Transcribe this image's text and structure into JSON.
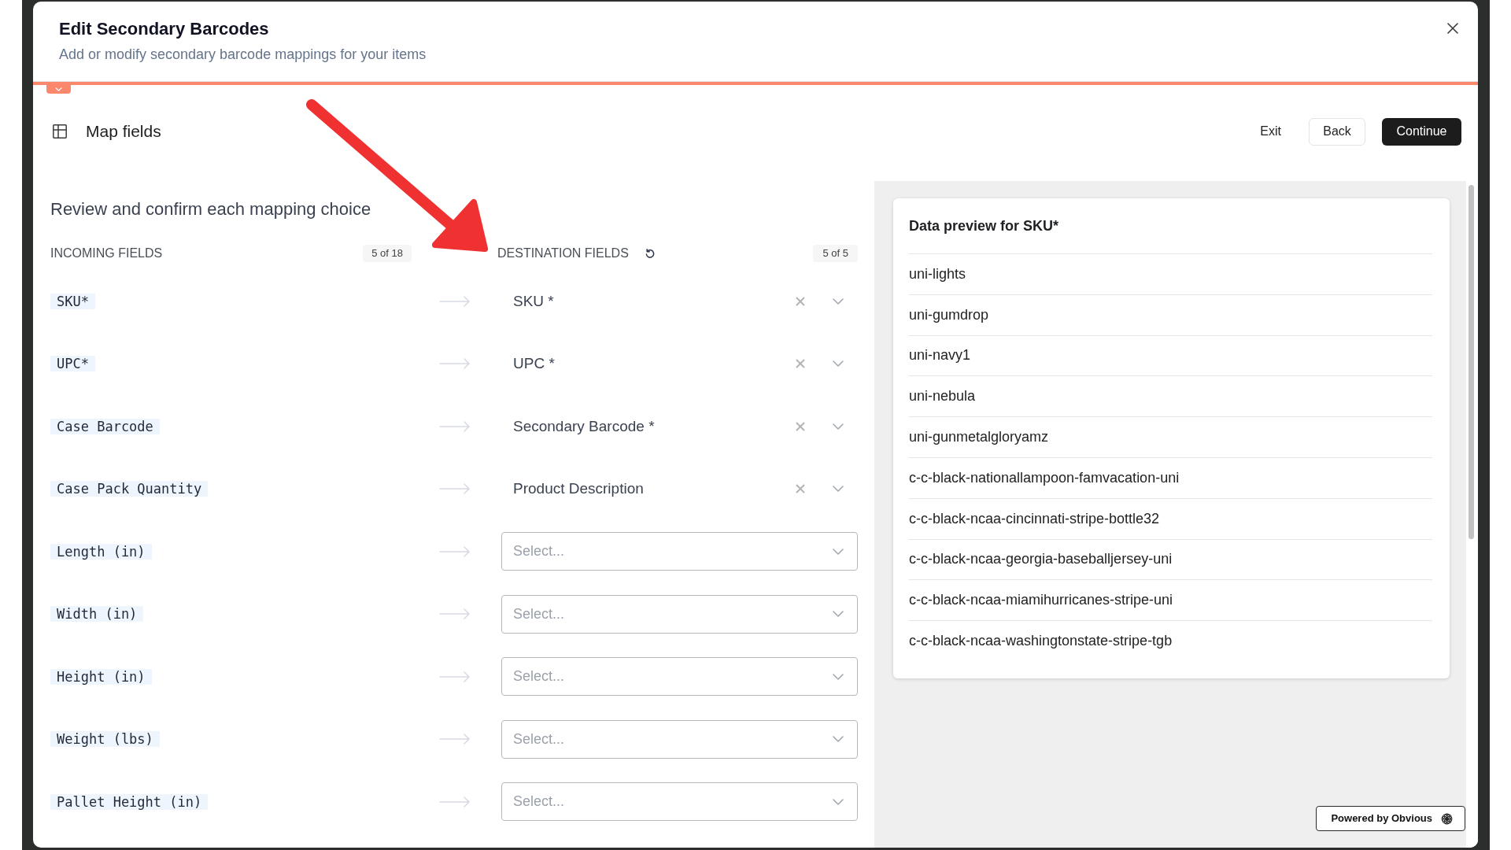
{
  "dialog": {
    "title": "Edit Secondary Barcodes",
    "subtitle": "Add or modify secondary barcode mappings for your items"
  },
  "header_toggle": {
    "expanded": true
  },
  "step": {
    "title": "Map fields",
    "actions": [
      {
        "label": "Exit",
        "kind": "text"
      },
      {
        "label": "Back",
        "kind": "outline"
      },
      {
        "label": "Continue",
        "kind": "primary"
      }
    ]
  },
  "mapping": {
    "heading": "Review and confirm each mapping choice",
    "incoming": {
      "label": "INCOMING FIELDS",
      "count": "5 of 18"
    },
    "destination": {
      "label": "DESTINATION FIELDS",
      "count": "5 of 5"
    },
    "rows": [
      {
        "incoming": "SKU*",
        "destination": {
          "kind": "mapped",
          "value": "SKU *"
        }
      },
      {
        "incoming": "UPC*",
        "destination": {
          "kind": "mapped",
          "value": "UPC *"
        }
      },
      {
        "incoming": "Case Barcode",
        "destination": {
          "kind": "mapped",
          "value": "Secondary Barcode *"
        }
      },
      {
        "incoming": "Case Pack Quantity",
        "destination": {
          "kind": "mapped",
          "value": "Product Description"
        }
      },
      {
        "incoming": "Length (in)",
        "destination": {
          "kind": "select",
          "placeholder": "Select..."
        }
      },
      {
        "incoming": "Width (in)",
        "destination": {
          "kind": "select",
          "placeholder": "Select..."
        }
      },
      {
        "incoming": "Height (in)",
        "destination": {
          "kind": "select",
          "placeholder": "Select..."
        }
      },
      {
        "incoming": "Weight (lbs)",
        "destination": {
          "kind": "select",
          "placeholder": "Select..."
        }
      },
      {
        "incoming": "Pallet Height (in)",
        "destination": {
          "kind": "select",
          "placeholder": "Select..."
        }
      }
    ]
  },
  "preview": {
    "title": "Data preview for SKU*",
    "values": [
      "uni-lights",
      "uni-gumdrop",
      "uni-navy1",
      "uni-nebula",
      "uni-gunmetalgloryamz",
      "c-c-black-nationallampoon-famvacation-uni",
      "c-c-black-ncaa-cincinnati-stripe-bottle32",
      "c-c-black-ncaa-georgia-baseballjersey-uni",
      "c-c-black-ncaa-miamihurricanes-stripe-uni",
      "c-c-black-ncaa-washingtonstate-stripe-tgb"
    ]
  },
  "footer": {
    "label": "Powered by Obvious"
  }
}
